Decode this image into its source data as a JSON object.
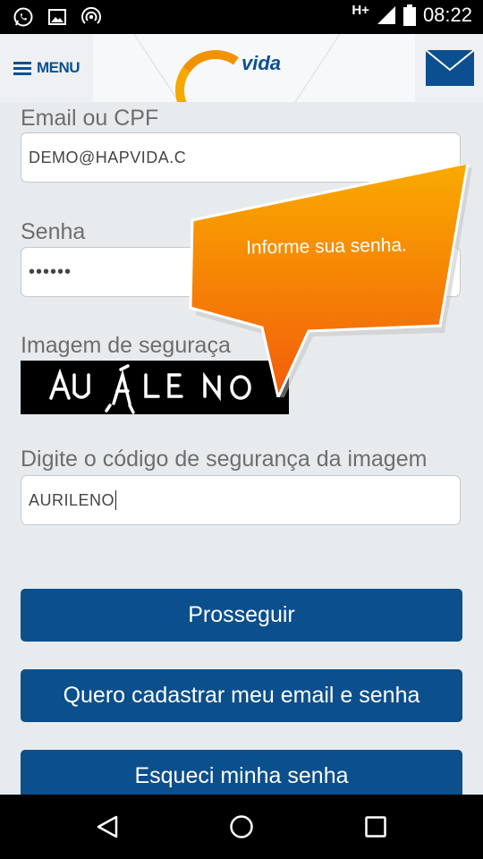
{
  "status_bar": {
    "network": "H+",
    "time": "08:22",
    "left_icons": [
      "whatsapp-icon",
      "image-icon",
      "hotspot-icon"
    ],
    "right_icons": [
      "signal-icon",
      "battery-icon"
    ]
  },
  "header": {
    "menu_label": "MENU",
    "logo_text": "vida",
    "icons": [
      "menu-icon",
      "hapvida-logo",
      "mail-icon"
    ]
  },
  "form": {
    "email_label": "Email ou CPF",
    "email_value": "DEMO@HAPVIDA.C",
    "password_label": "Senha",
    "password_value": "••••••",
    "captcha_label": "Imagem de seguraça",
    "captcha_text": "AURILENO",
    "code_label": "Digite o código de segurança da imagem",
    "code_value": "AURILENO"
  },
  "buttons": {
    "proceed": "Prosseguir",
    "register": "Quero cadastrar meu email e senha",
    "forgot": "Esqueci minha senha"
  },
  "tooltip": {
    "text": "Informe sua senha."
  },
  "colors": {
    "brand_blue": "#0b4f8c",
    "orange_top": "#f7a400",
    "orange_bottom": "#f25a0a",
    "label_gray": "#6d6d6d"
  },
  "navbar": {
    "icons": [
      "back-icon",
      "home-icon",
      "recents-icon"
    ]
  }
}
